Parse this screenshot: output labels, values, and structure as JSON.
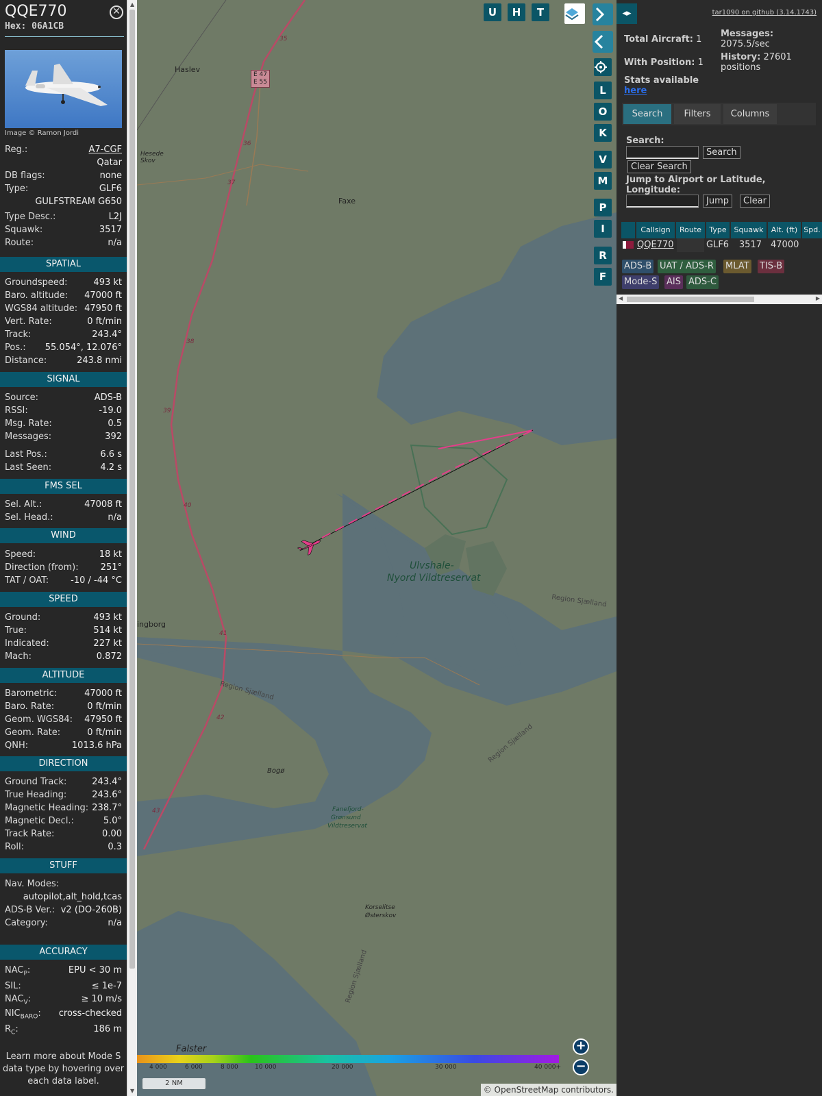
{
  "aircraft": {
    "callsign": "QQE770",
    "hex": "Hex: 06A1CB",
    "photo_credit": "Image © Ramon Jordi"
  },
  "details": [
    {
      "label": "Reg.:",
      "value": "A7-CGF"
    },
    {
      "label": "",
      "value": "Qatar"
    },
    {
      "label": "DB flags:",
      "value": "none"
    },
    {
      "label": "Type:",
      "value": "GLF6"
    },
    {
      "label": "",
      "value": "GULFSTREAM G650"
    },
    {
      "label": "Type Desc.:",
      "value": "L2J"
    },
    {
      "label": "Squawk:",
      "value": "3517"
    },
    {
      "label": "Route:",
      "value": "n/a"
    }
  ],
  "sections": {
    "spatial": "SPATIAL",
    "signal": "SIGNAL",
    "fms": "FMS SEL",
    "wind": "WIND",
    "speed": "SPEED",
    "altitude": "ALTITUDE",
    "direction": "DIRECTION",
    "stuff": "STUFF",
    "accuracy": "ACCURACY"
  },
  "spatial": [
    {
      "label": "Groundspeed:",
      "value": "493 kt"
    },
    {
      "label": "Baro. altitude:",
      "value": "47000 ft"
    },
    {
      "label": "WGS84 altitude:",
      "value": "47950 ft"
    },
    {
      "label": "Vert. Rate:",
      "value": "0 ft/min"
    },
    {
      "label": "Track:",
      "value": "243.4°"
    },
    {
      "label": "Pos.:",
      "value": "55.054°, 12.076°"
    },
    {
      "label": "Distance:",
      "value": "243.8 nmi"
    }
  ],
  "signal": [
    {
      "label": "Source:",
      "value": "ADS-B"
    },
    {
      "label": "RSSI:",
      "value": "-19.0"
    },
    {
      "label": "Msg. Rate:",
      "value": "0.5"
    },
    {
      "label": "Messages:",
      "value": "392"
    },
    {
      "label": "Last Pos.:",
      "value": "6.6 s"
    },
    {
      "label": "Last Seen:",
      "value": "4.2 s"
    }
  ],
  "fms": [
    {
      "label": "Sel. Alt.:",
      "value": "47008 ft"
    },
    {
      "label": "Sel. Head.:",
      "value": "n/a"
    }
  ],
  "wind": [
    {
      "label": "Speed:",
      "value": "18 kt"
    },
    {
      "label": "Direction (from):",
      "value": "251°"
    },
    {
      "label": "TAT / OAT:",
      "value": "-10 / -44 °C"
    }
  ],
  "speed": [
    {
      "label": "Ground:",
      "value": "493 kt"
    },
    {
      "label": "True:",
      "value": "514 kt"
    },
    {
      "label": "Indicated:",
      "value": "227 kt"
    },
    {
      "label": "Mach:",
      "value": "0.872"
    }
  ],
  "altitude": [
    {
      "label": "Barometric:",
      "value": "47000 ft"
    },
    {
      "label": "Baro. Rate:",
      "value": "0 ft/min"
    },
    {
      "label": "Geom. WGS84:",
      "value": "47950 ft"
    },
    {
      "label": "Geom. Rate:",
      "value": "0 ft/min"
    },
    {
      "label": "QNH:",
      "value": "1013.6 hPa"
    }
  ],
  "direction": [
    {
      "label": "Ground Track:",
      "value": "243.4°"
    },
    {
      "label": "True Heading:",
      "value": "243.6°"
    },
    {
      "label": "Magnetic Heading:",
      "value": "238.7°"
    },
    {
      "label": "Magnetic Decl.:",
      "value": "5.0°"
    },
    {
      "label": "Track Rate:",
      "value": "0.00"
    },
    {
      "label": "Roll:",
      "value": "0.3"
    }
  ],
  "stuff": {
    "nav_modes_label": "Nav. Modes:",
    "nav_modes_value": "autopilot,alt_hold,tcas",
    "adsb_label": "ADS-B Ver.:",
    "adsb_value": "v2 (DO-260B)",
    "category_label": "Category:",
    "category_value": "n/a"
  },
  "accuracy": {
    "nacp_label": "NAC",
    "nacp_sub": "P",
    "nacp_value": "EPU < 30 m",
    "sil_label": "SIL:",
    "sil_value": "≤ 1e-7",
    "nacv_label": "NAC",
    "nacv_sub": "V",
    "nacv_value": "≥ 10 m/s",
    "nicbaro_label": "NIC",
    "nicbaro_sub": "BARO",
    "nicbaro_value": "cross-checked",
    "rc_label": "R",
    "rc_sub": "C",
    "rc_value": "186 m"
  },
  "learn_more": "Learn more about Mode S data type by hovering over each data label.",
  "map": {
    "buttons": [
      "U",
      "H",
      "T"
    ],
    "side_buttons": [
      "L",
      "O",
      "K",
      "V",
      "M",
      "P",
      "I",
      "R",
      "F"
    ],
    "labels": {
      "haslev": "Haslev",
      "faxe": "Faxe",
      "hesede": "Hesede Skov",
      "e47": "E 47",
      "e55": "E 55",
      "reserve1": "Ulvshale-",
      "reserve2": "Nyord Vildtreservat",
      "region1": "Region Sjælland",
      "region2": "Region Sjælland",
      "region3": "Region Sjælland",
      "region4": "Region Sjælland",
      "vordingborg": "ingborg",
      "bogo": "Bogø",
      "fanefjord": "Fanefjord-",
      "gronsund": "Grønsund",
      "vildtres": "Vildtreservat",
      "korselitse": "Korselitse",
      "osterskov": "Østerskov",
      "falster": "Falster",
      "r35": "35",
      "r36": "36",
      "r37": "37",
      "r38": "38",
      "r39": "39",
      "r40": "40",
      "r41": "41",
      "r42": "42",
      "r43": "43"
    },
    "altitude_scale": [
      "4 000",
      "6 000",
      "8 000",
      "10 000",
      "20 000",
      "30 000",
      "40 000+"
    ],
    "scale_bar": "2 NM",
    "attribution": "© OpenStreetMap contributors."
  },
  "right": {
    "github": "tar1090 on github (3.14.1743)",
    "total_label": "Total Aircraft:",
    "total_value": "1",
    "withpos_label": "With Position:",
    "withpos_value": "1",
    "stats_label": "Stats available",
    "stats_link": "here",
    "messages_label": "Messages:",
    "messages_value": "2075.5/sec",
    "history_label": "History:",
    "history_value": "27601 positions",
    "tabs": [
      "Search",
      "Filters",
      "Columns"
    ],
    "search_label": "Search:",
    "search_button": "Search",
    "clear_search_button": "Clear Search",
    "jump_label": "Jump to Airport or Latitude, Longitude:",
    "jump_button": "Jump",
    "clear_button": "Clear",
    "columns": [
      "Callsign",
      "Route",
      "Type",
      "Squawk",
      "Alt. (ft)",
      "Spd."
    ],
    "row": {
      "callsign": "QQE770",
      "route": "",
      "type": "GLF6",
      "squawk": "3517",
      "alt": "47000"
    },
    "legend": [
      {
        "label": "ADS-B",
        "bg": "#2f4f6b"
      },
      {
        "label": "UAT / ADS-R",
        "bg": "#2f5e3e"
      },
      {
        "label": "MLAT",
        "bg": "#6b5a2f"
      },
      {
        "label": "TIS-B",
        "bg": "#6b2f3e"
      },
      {
        "label": "Mode-S",
        "bg": "#3e3e6b"
      },
      {
        "label": "AIS",
        "bg": "#5a2f5a"
      },
      {
        "label": "ADS-C",
        "bg": "#2f5a3e"
      }
    ]
  }
}
